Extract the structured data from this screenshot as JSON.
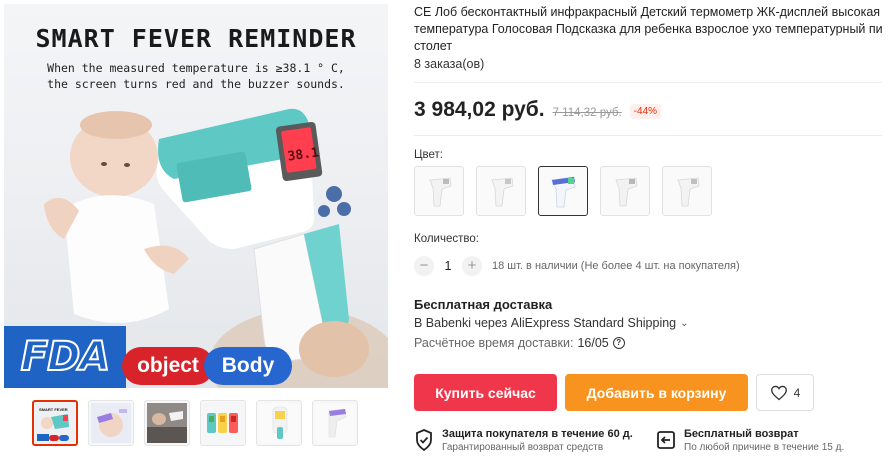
{
  "product": {
    "title": "CE Лоб бесконтактный инфракрасный Детский термометр ЖК-дисплей высокая температура Голосовая Подсказка для ребенка взрослое ухо температурный пи столет",
    "orders": "8 заказа(ов)",
    "price": "3 984,02 руб.",
    "old_price": "7 114,32 руб.",
    "discount": "-44%"
  },
  "main_image": {
    "headline": "SMART FEVER REMINDER",
    "subline": "When the measured temperature is ≥38.1 ° C,\nthe screen turns red and the buzzer sounds.",
    "screen_reading": "38.1",
    "badge": "FDA",
    "pill_left": "object",
    "pill_right": "Body"
  },
  "color": {
    "label": "Цвет:",
    "options": [
      "option-1",
      "option-2",
      "option-3",
      "option-4",
      "option-5"
    ],
    "selected_index": 2
  },
  "quantity": {
    "label": "Количество:",
    "value": "1",
    "minus": "−",
    "plus": "+",
    "note": "18 шт. в наличии (Не более 4 шт. на покупателя)"
  },
  "shipping": {
    "title": "Бесплатная доставка",
    "via": "В Babenki через AliExpress Standard Shipping",
    "eta_label": "Расчётное время доставки:",
    "eta_value": "16/05"
  },
  "actions": {
    "buy_now": "Купить сейчас",
    "add_to_cart": "Добавить в корзину",
    "wishlist_count": "4"
  },
  "guarantees": [
    {
      "title": "Защита покупателя в течение 60 д.",
      "sub": "Гарантированный возврат средств"
    },
    {
      "title": "Бесплатный возврат",
      "sub": "По любой причине в течение 15 д."
    }
  ],
  "colors": {
    "accent_red": "#f0364a",
    "accent_orange": "#f7931e",
    "thermometer_teal": "#5ec8c4",
    "fda_blue": "#1f63c4"
  }
}
